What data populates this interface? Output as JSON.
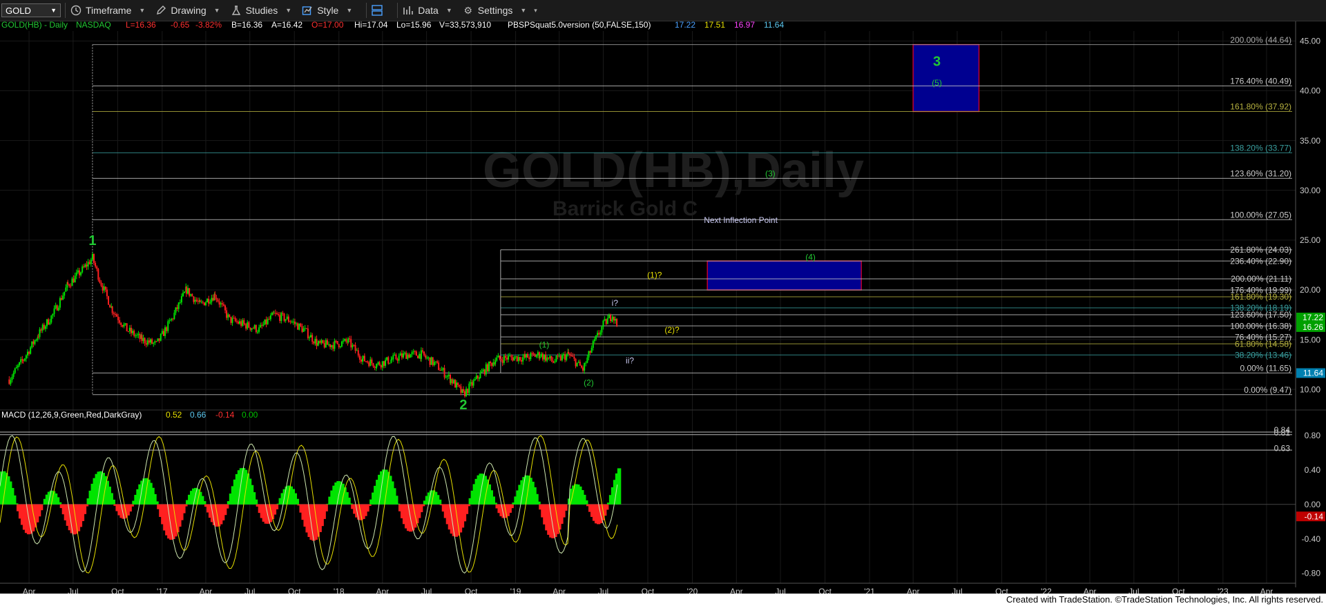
{
  "toolbar": {
    "symbol": "GOLD",
    "menus": [
      "Timeframe",
      "Drawing",
      "Studies",
      "Style",
      "Data",
      "Settings"
    ],
    "icons": [
      "clock-icon",
      "pencil-icon",
      "flask-icon",
      "chart-style-icon",
      "layout-icon",
      "data-icon",
      "gear-icon"
    ]
  },
  "header": {
    "title": "GOLD(HB) - Daily",
    "exchange": "NASDAQ",
    "last": "L=16.36",
    "change": "-0.65",
    "pct": "-3.82%",
    "bid": "B=16.36",
    "ask": "A=16.42",
    "open": "O=17.00",
    "hi": "Hi=17.04",
    "lo": "Lo=15.96",
    "vol": "V=33,573,910",
    "study": "PBSPSquat5.0version (50,FALSE,150)",
    "values": [
      "17.22",
      "17.51",
      "16.97",
      "11.64"
    ]
  },
  "watermark": {
    "line1": "GOLD(HB),Daily",
    "line2": "Barrick Gold C"
  },
  "colors": {
    "up": "#00e400",
    "down": "#ff2020",
    "wave": "#22c833",
    "wave_yellow": "#e7e000",
    "box_fill": "#000090",
    "price_tag_green": "#00a000",
    "price_tag_blue": "#0080b0"
  },
  "chart_data": [
    {
      "type": "candlestick",
      "title": "GOLD(HB) - Daily",
      "ylim": [
        8,
        46
      ],
      "y_ticks": [
        10,
        15,
        20,
        25,
        30,
        35,
        40,
        45
      ],
      "y_tick_labels": [
        "10.00",
        "15.00",
        "20.00",
        "25.00",
        "30.00",
        "35.00",
        "40.00",
        "45.00"
      ],
      "x_ticks": [
        "Apr",
        "Jul",
        "Oct",
        "'17",
        "Apr",
        "Jul",
        "Oct",
        "'18",
        "Apr",
        "Jul",
        "Oct",
        "'19",
        "Apr",
        "Jul",
        "Oct",
        "'20",
        "Apr",
        "Jul",
        "Oct",
        "'21",
        "Apr",
        "Jul",
        "Oct",
        "'22",
        "Apr",
        "Jul",
        "Oct",
        "'23",
        "Apr"
      ],
      "close_approx": [
        [
          "2016-02-20",
          11.0
        ],
        [
          "2016-03-20",
          13.0
        ],
        [
          "2016-04-20",
          15.5
        ],
        [
          "2016-05-20",
          17.5
        ],
        [
          "2016-06-20",
          20.5
        ],
        [
          "2016-07-20",
          22.0
        ],
        [
          "2016-08-10",
          23.2
        ],
        [
          "2016-08-25",
          21.0
        ],
        [
          "2016-09-20",
          18.0
        ],
        [
          "2016-10-20",
          16.0
        ],
        [
          "2016-11-20",
          15.0
        ],
        [
          "2016-12-20",
          14.5
        ],
        [
          "2017-01-20",
          17.0
        ],
        [
          "2017-02-20",
          20.0
        ],
        [
          "2017-03-20",
          18.5
        ],
        [
          "2017-04-20",
          19.5
        ],
        [
          "2017-05-20",
          17.0
        ],
        [
          "2017-06-20",
          16.5
        ],
        [
          "2017-07-20",
          16.0
        ],
        [
          "2017-08-20",
          17.5
        ],
        [
          "2017-09-20",
          17.0
        ],
        [
          "2017-10-20",
          16.0
        ],
        [
          "2017-11-20",
          14.5
        ],
        [
          "2017-12-20",
          14.5
        ],
        [
          "2018-01-20",
          14.8
        ],
        [
          "2018-02-20",
          13.0
        ],
        [
          "2018-03-20",
          12.5
        ],
        [
          "2018-04-20",
          13.0
        ],
        [
          "2018-05-20",
          13.5
        ],
        [
          "2018-06-20",
          13.5
        ],
        [
          "2018-07-20",
          12.5
        ],
        [
          "2018-08-20",
          11.0
        ],
        [
          "2018-09-15",
          9.5
        ],
        [
          "2018-10-20",
          11.5
        ],
        [
          "2018-11-20",
          13.0
        ],
        [
          "2018-12-20",
          13.2
        ],
        [
          "2019-01-20",
          13.2
        ],
        [
          "2019-02-20",
          13.5
        ],
        [
          "2019-03-20",
          12.8
        ],
        [
          "2019-04-20",
          13.5
        ],
        [
          "2019-05-20",
          12.0
        ],
        [
          "2019-06-10",
          14.5
        ],
        [
          "2019-07-01",
          16.5
        ],
        [
          "2019-07-20",
          17.5
        ],
        [
          "2019-07-30",
          16.36
        ]
      ],
      "fib_levels": [
        {
          "label": "200.00% (44.64)",
          "value": 44.64,
          "color": "#aaaaaa"
        },
        {
          "label": "176.40% (40.49)",
          "value": 40.49,
          "color": "#cccccc"
        },
        {
          "label": "161.80% (37.92)",
          "value": 37.92,
          "color": "#b8b340"
        },
        {
          "label": "138.20% (33.77)",
          "value": 33.77,
          "color": "#3aa0a0"
        },
        {
          "label": "123.60% (31.20)",
          "value": 31.2,
          "color": "#cccccc"
        },
        {
          "label": "100.00% (27.05)",
          "value": 27.05,
          "color": "#cccccc"
        },
        {
          "label": "0.00% (11.65)",
          "value": 11.65,
          "color": "#cccccc"
        },
        {
          "label": "0.00% (9.47)",
          "value": 9.47,
          "color": "#cccccc"
        }
      ],
      "fib_levels_right": [
        {
          "label": "261.80% (24.03)",
          "value": 24.03,
          "color": "#cccccc"
        },
        {
          "label": "236.40% (22.90)",
          "value": 22.9,
          "color": "#cccccc"
        },
        {
          "label": "200.00% (21.11)",
          "value": 21.11,
          "color": "#cccccc"
        },
        {
          "label": "176.40% (19.99)",
          "value": 19.99,
          "color": "#cccccc"
        },
        {
          "label": "161.80% (19.30)",
          "value": 19.3,
          "color": "#b8b340"
        },
        {
          "label": "138.20% (18.19)",
          "value": 18.19,
          "color": "#3aa0a0"
        },
        {
          "label": "123.60% (17.50)",
          "value": 17.5,
          "color": "#cccccc"
        },
        {
          "label": "100.00% (16.38)",
          "value": 16.38,
          "color": "#cccccc"
        },
        {
          "label": "76.40% (15.27)",
          "value": 15.27,
          "color": "#cccccc"
        },
        {
          "label": "61.80% (14.58)",
          "value": 14.58,
          "color": "#b8b340"
        },
        {
          "label": "38.20% (13.46)",
          "value": 13.46,
          "color": "#3aa0a0"
        }
      ],
      "annotations": [
        {
          "text": "1",
          "date": "2016-08-10",
          "value": 25.0,
          "color": "#22c833",
          "size": "large"
        },
        {
          "text": "2",
          "date": "2018-09-15",
          "value": 8.5,
          "color": "#22c833",
          "size": "large"
        },
        {
          "text": "3",
          "date": "2021-05-20",
          "value": 43.0,
          "color": "#22c833",
          "size": "large"
        },
        {
          "text": "(5)",
          "date": "2021-05-20",
          "value": 40.8,
          "color": "#22c833",
          "size": "small"
        },
        {
          "text": "(3)",
          "date": "2020-06-10",
          "value": 31.7,
          "color": "#22c833",
          "size": "small"
        },
        {
          "text": "Next Inflection Point",
          "date": "2020-04-10",
          "value": 27.0,
          "color": "#c8c8f0",
          "size": "small"
        },
        {
          "text": "(4)",
          "date": "2020-09-01",
          "value": 23.3,
          "color": "#22c833",
          "size": "small"
        },
        {
          "text": "(1)?",
          "date": "2019-10-15",
          "value": 21.5,
          "color": "#e7e000",
          "size": "small"
        },
        {
          "text": "i?",
          "date": "2019-07-25",
          "value": 18.7,
          "color": "#c8c8f0",
          "size": "small"
        },
        {
          "text": "(2)?",
          "date": "2019-11-20",
          "value": 16.0,
          "color": "#e7e000",
          "size": "small"
        },
        {
          "text": "ii?",
          "date": "2019-08-25",
          "value": 12.9,
          "color": "#c8c8f0",
          "size": "small"
        },
        {
          "text": "(1)",
          "date": "2019-03-01",
          "value": 14.5,
          "color": "#22c833",
          "size": "small"
        },
        {
          "text": "(2)",
          "date": "2019-06-01",
          "value": 10.7,
          "color": "#22c833",
          "size": "small"
        }
      ],
      "price_tags": [
        {
          "text": "17.22",
          "value": 17.22,
          "bg": "#00a000"
        },
        {
          "text": "16.26",
          "value": 16.26,
          "bg": "#00a000"
        },
        {
          "text": "11.64",
          "value": 11.64,
          "bg": "#0080b0"
        }
      ],
      "boxes": [
        {
          "x0": "2021-04-01",
          "x1": "2021-08-15",
          "y0": 37.92,
          "y1": 44.64,
          "fill": "#000090"
        },
        {
          "x0": "2020-02-01",
          "x1": "2020-12-15",
          "y0": 19.99,
          "y1": 22.9,
          "fill": "#000090"
        }
      ]
    },
    {
      "type": "bar",
      "title": "MACD (12,26,9,Green,Red,DarkGray)",
      "values_label": [
        "0.52",
        "0.66",
        "-0.14",
        "0.00"
      ],
      "ylim": [
        -0.9,
        1.0
      ],
      "y_ticks": [
        0.8,
        0.4,
        0.0,
        -0.4,
        -0.8
      ],
      "y_tick_labels": [
        "0.80",
        "0.40",
        "0.00",
        "-0.40",
        "-0.80"
      ],
      "levels": [
        {
          "label": "0.84",
          "value": 0.84
        },
        {
          "label": "0.81",
          "value": 0.81
        },
        {
          "label": "0.63",
          "value": 0.63
        }
      ],
      "last_tag": {
        "text": "-0.14",
        "bg": "#c00000"
      }
    }
  ],
  "footer": {
    "text": "Created with TradeStation. ©TradeStation Technologies, Inc. All rights reserved."
  }
}
